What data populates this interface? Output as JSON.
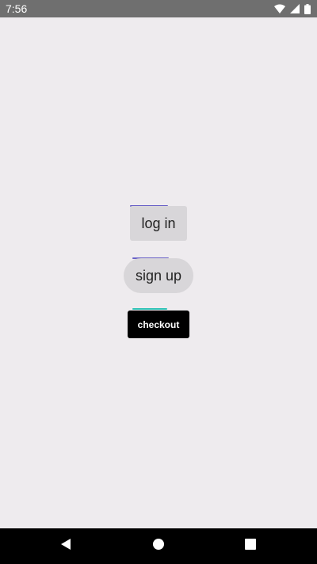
{
  "status_bar": {
    "time": "7:56",
    "icons": [
      "wifi-icon",
      "cellular-signal-icon",
      "battery-icon"
    ]
  },
  "buttons": {
    "login_label": "log in",
    "signup_label": "sign up",
    "checkout_label": "checkout"
  },
  "colors": {
    "background": "#eeebee",
    "status_bar": "#6f6f6f",
    "button_gray": "#d8d6d9",
    "checkout_bg": "#000000",
    "accent_purple": "#6a62c8",
    "accent_teal": "#2fc2b6"
  },
  "nav_bar": {
    "icons": [
      "back-icon",
      "home-icon",
      "recents-icon"
    ]
  }
}
